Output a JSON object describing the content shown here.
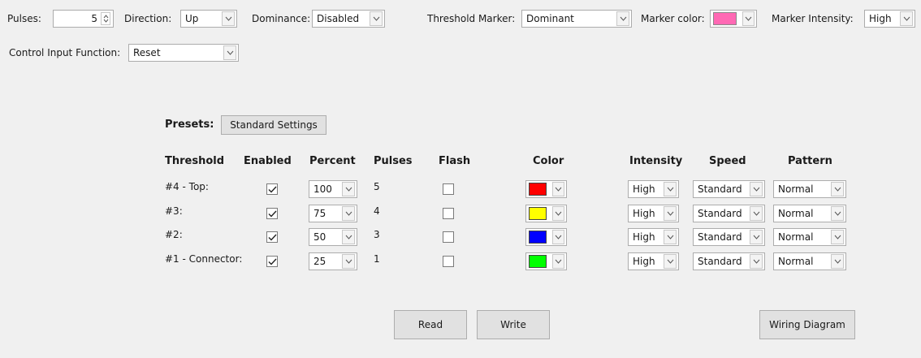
{
  "top": {
    "pulses_label": "Pulses:",
    "pulses_value": "5",
    "direction_label": "Direction:",
    "direction_value": "Up",
    "dominance_label": "Dominance:",
    "dominance_value": "Disabled",
    "threshold_marker_label": "Threshold Marker:",
    "threshold_marker_value": "Dominant",
    "marker_color_label": "Marker color:",
    "marker_color": "#ff69b4",
    "marker_intensity_label": "Marker Intensity:",
    "marker_intensity_value": "High",
    "control_input_label": "Control Input Function:",
    "control_input_value": "Reset"
  },
  "presets": {
    "label": "Presets:",
    "button": "Standard Settings"
  },
  "table": {
    "headers": {
      "threshold": "Threshold",
      "enabled": "Enabled",
      "percent": "Percent",
      "pulses": "Pulses",
      "flash": "Flash",
      "color": "Color",
      "intensity": "Intensity",
      "speed": "Speed",
      "pattern": "Pattern"
    },
    "rows": [
      {
        "name": "#4 - Top:",
        "enabled": true,
        "percent": "100",
        "pulses": "5",
        "flash": false,
        "color": "#ff0000",
        "intensity": "High",
        "speed": "Standard",
        "pattern": "Normal"
      },
      {
        "name": "#3:",
        "enabled": true,
        "percent": "75",
        "pulses": "4",
        "flash": false,
        "color": "#ffff00",
        "intensity": "High",
        "speed": "Standard",
        "pattern": "Normal"
      },
      {
        "name": "#2:",
        "enabled": true,
        "percent": "50",
        "pulses": "3",
        "flash": false,
        "color": "#0000ff",
        "intensity": "High",
        "speed": "Standard",
        "pattern": "Normal"
      },
      {
        "name": "#1 - Connector:",
        "enabled": true,
        "percent": "25",
        "pulses": "1",
        "flash": false,
        "color": "#00ff00",
        "intensity": "High",
        "speed": "Standard",
        "pattern": "Normal"
      }
    ]
  },
  "buttons": {
    "read": "Read",
    "write": "Write",
    "wiring": "Wiring Diagram"
  }
}
